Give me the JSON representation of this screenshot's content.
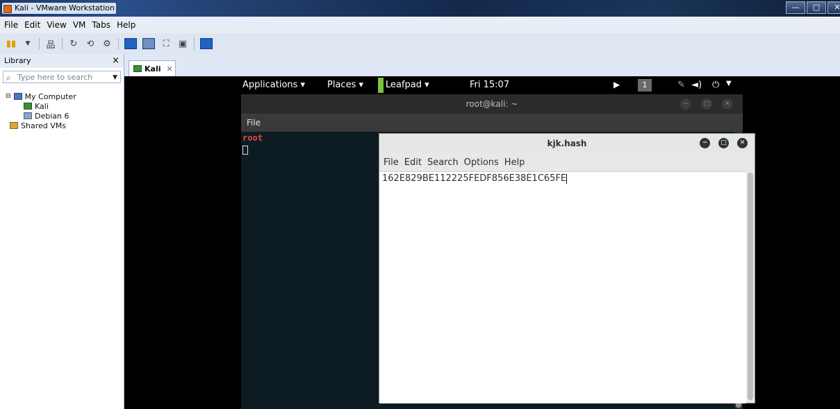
{
  "window": {
    "title": "Kali - VMware Workstation"
  },
  "menubar": {
    "items": [
      "File",
      "Edit",
      "View",
      "VM",
      "Tabs",
      "Help"
    ]
  },
  "library": {
    "title": "Library",
    "search_placeholder": "Type here to search",
    "tree": {
      "root": "My Computer",
      "vms": [
        "Kali",
        "Debian 6"
      ],
      "shared": "Shared VMs"
    }
  },
  "tabs": [
    {
      "label": "Kali",
      "active": true
    }
  ],
  "gnome_bar": {
    "applications": "Applications ▾",
    "places": "Places ▾",
    "app": "Leafpad ▾",
    "clock": "Fri 15:07",
    "workspace": "1"
  },
  "terminal": {
    "title": "root@kali: ~",
    "menu": "File",
    "prompt": "root"
  },
  "leafpad": {
    "title": "kjk.hash",
    "menu": [
      "File",
      "Edit",
      "Search",
      "Options",
      "Help"
    ],
    "content": "162E829BE112225FEDF856E38E1C65FE"
  },
  "colors": {
    "kali_prompt": "#e64545",
    "leafpad_task": "#7dc242",
    "vmware_title_bg": "#1d3766"
  }
}
